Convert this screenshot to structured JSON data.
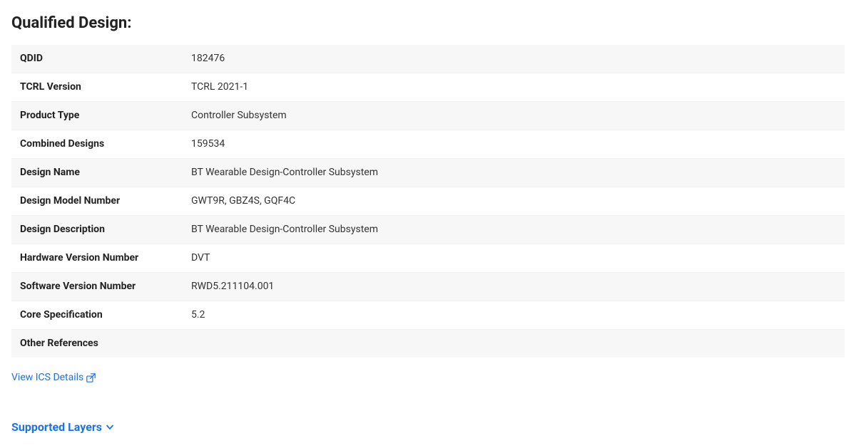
{
  "page": {
    "title": "Qualified Design:"
  },
  "table": {
    "rows": [
      {
        "label": "QDID",
        "value": "182476"
      },
      {
        "label": "TCRL Version",
        "value": "TCRL 2021-1"
      },
      {
        "label": "Product Type",
        "value": "Controller Subsystem"
      },
      {
        "label": "Combined Designs",
        "value": "159534"
      },
      {
        "label": "Design Name",
        "value": "BT Wearable Design-Controller Subsystem"
      },
      {
        "label": "Design Model Number",
        "value": "GWT9R, GBZ4S, GQF4C"
      },
      {
        "label": "Design Description",
        "value": "BT Wearable Design-Controller Subsystem"
      },
      {
        "label": "Hardware Version Number",
        "value": "DVT"
      },
      {
        "label": "Software Version Number",
        "value": "RWD5.211104.001"
      },
      {
        "label": "Core Specification",
        "value": "5.2"
      },
      {
        "label": "Other References",
        "value": ""
      }
    ]
  },
  "links": {
    "view_ics": "View ICS Details"
  },
  "supported_layers": {
    "heading": "Supported Layers"
  }
}
